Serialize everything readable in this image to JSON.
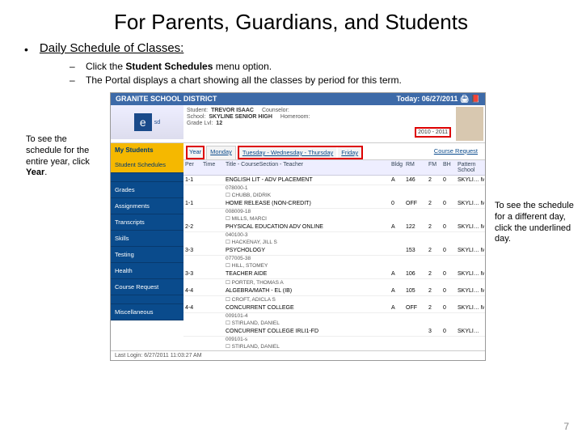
{
  "title": "For Parents, Guardians, and Students",
  "main_bullet": "Daily Schedule of Classes:",
  "subs": {
    "a_pre": "Click the ",
    "a_bold": "Student Schedules",
    "a_post": " menu option.",
    "b": "The Portal displays a chart showing all the classes by period for this term."
  },
  "callout_left_pre": "To see the schedule for the entire year, click ",
  "callout_left_bold": "Year",
  "callout_left_post": ".",
  "callout_right": "To see the schedule for a different day, click the underlined day.",
  "page_num": "7",
  "ss": {
    "district": "GRANITE SCHOOL DISTRICT",
    "today_lbl": "Today:",
    "today_val": "06/27/2011",
    "student_lbl": "Student:",
    "student_val": "TREVOR ISAAC",
    "counselor_lbl": "Counselor:",
    "school_lbl": "School:",
    "school_val": "SKYLINE SENIOR HIGH",
    "grade_lbl": "Grade Lvl:",
    "grade_val": "12",
    "homeroom_lbl": "Homeroom:",
    "year": "2010 - 2011",
    "side_header": "My Students",
    "side": [
      "Student Schedules",
      "",
      "Grades",
      "Assignments",
      "Transcripts",
      "Skills",
      "Testing",
      "Health",
      "Course Request",
      "",
      "Miscellaneous"
    ],
    "tabs": {
      "year": "Year",
      "mon": "Monday",
      "twt": "Tuesday - Wednesday - Thursday",
      "fri": "Friday",
      "cr": "Course Request"
    },
    "thead": [
      "Per",
      "Time",
      "Title - CourseSection - Teacher",
      "Bldg",
      "RM",
      "FM",
      "BH",
      "Pattern School"
    ],
    "rows": [
      {
        "per": "1-1",
        "t": "",
        "title": "ENGLISH LIT - ADV PLACEMENT",
        "b": "A",
        "rm": "146",
        "fm": "2",
        "bh": "0",
        "ps": "SKYLI… MAIN …",
        "sub": "078000-1",
        "teach": "☐ CHUBB, DIDRIK"
      },
      {
        "per": "1-1",
        "t": "",
        "title": "HOME RELEASE (NON-CREDIT)",
        "b": "0",
        "rm": "OFF",
        "fm": "2",
        "bh": "0",
        "ps": "SKYLI… MAIN …",
        "sub": "008009-18",
        "teach": "☐ MILLS, MARCI"
      },
      {
        "per": "2-2",
        "t": "",
        "title": "PHYSICAL EDUCATION ADV ONLINE",
        "b": "A",
        "rm": "122",
        "fm": "2",
        "bh": "0",
        "ps": "SKYLI… MAIN …",
        "sub": "040100-3",
        "teach": "☐ HACKENAY, JILL S"
      },
      {
        "per": "3-3",
        "t": "",
        "title": "PSYCHOLOGY",
        "b": "",
        "rm": "153",
        "fm": "2",
        "bh": "0",
        "ps": "SKYLI… MAIN …",
        "sub": "077005-38",
        "teach": "☐ HILL, STOMEY"
      },
      {
        "per": "3-3",
        "t": "",
        "title": "TEACHER AIDE",
        "b": "A",
        "rm": "106",
        "fm": "2",
        "bh": "0",
        "ps": "SKYLI… MAIN …",
        "sub": "",
        "teach": "☐ PORTER, THOMAS A"
      },
      {
        "per": "4-4",
        "t": "",
        "title": "ALGEBRA/MATH - EL (IB)",
        "b": "A",
        "rm": "105",
        "fm": "2",
        "bh": "0",
        "ps": "SKYLI… MAIN …",
        "sub": "",
        "teach": "☐ CROFT, ADICLA S"
      },
      {
        "per": "4-4",
        "t": "",
        "title": "CONCURRENT COLLEGE",
        "b": "A",
        "rm": "OFF",
        "fm": "2",
        "bh": "0",
        "ps": "SKYLI… MAIN …",
        "sub": "009101-4",
        "teach": "☐ STIRLAND, DANIEL"
      },
      {
        "per": "",
        "t": "",
        "title": "CONCURRENT COLLEGE IRLI1-FD",
        "b": "",
        "rm": "",
        "fm": "3",
        "bh": "0",
        "ps": "SKYLI…",
        "sub": "009101-s",
        "teach": "☐ STIRLAND, DANIEL"
      }
    ],
    "foot": "Last Login: 6/27/2011 11:03:27 AM"
  }
}
